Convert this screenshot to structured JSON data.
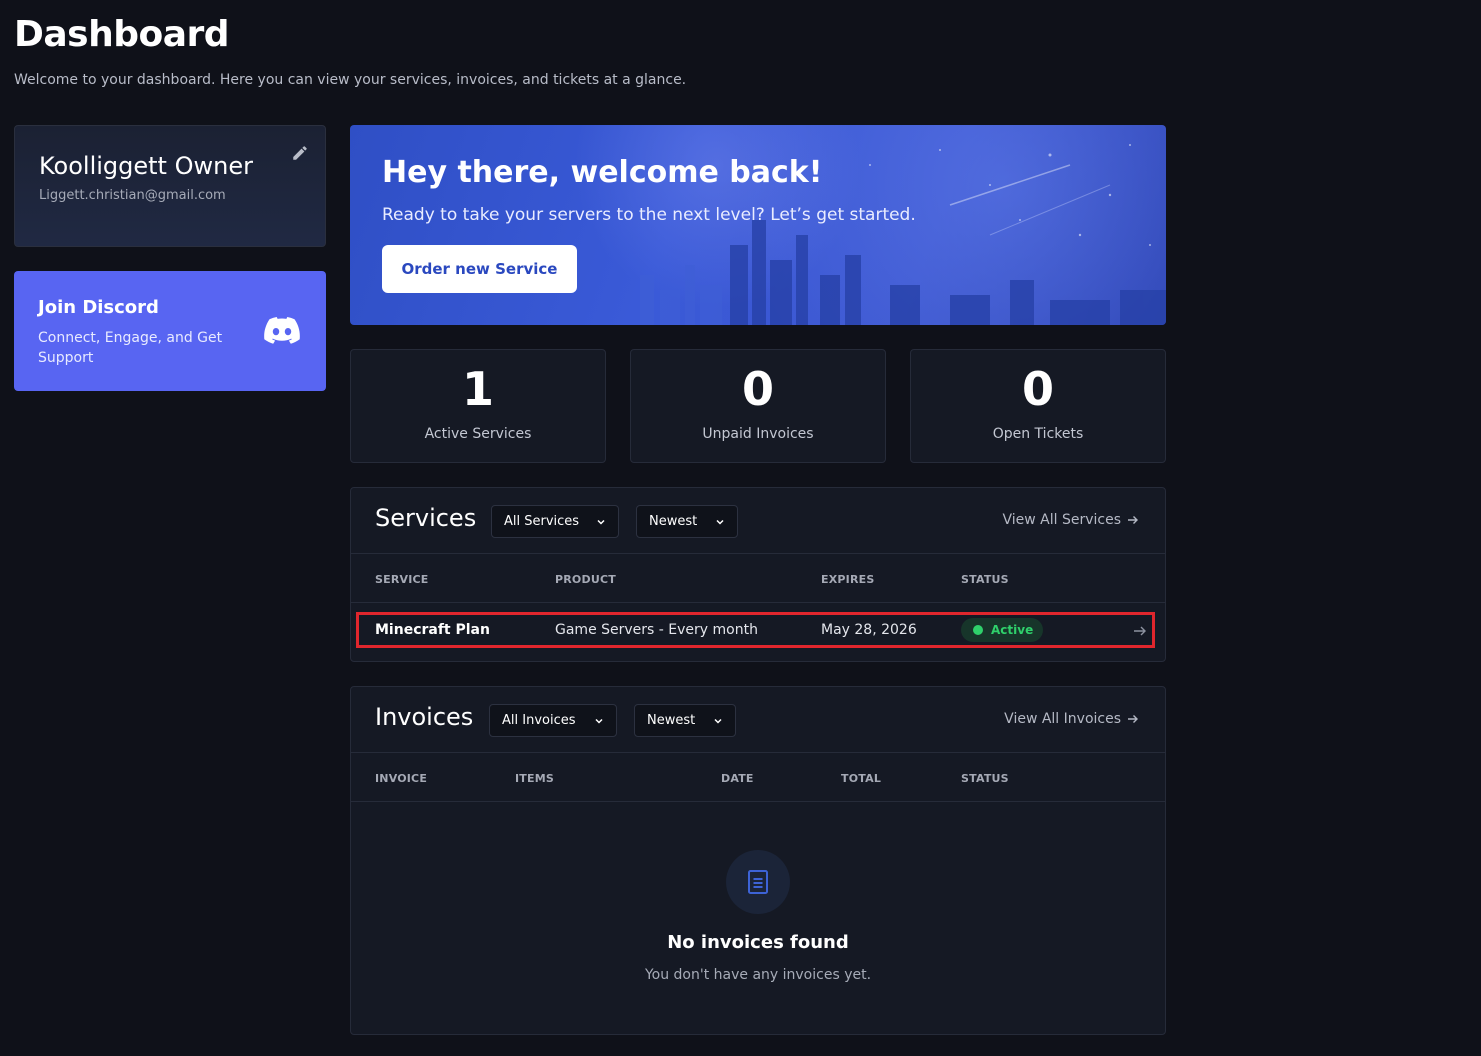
{
  "page": {
    "title": "Dashboard",
    "subtitle": "Welcome to your dashboard. Here you can view your services, invoices, and tickets at a glance."
  },
  "profile": {
    "name": "Koolliggett Owner",
    "email": "Liggett.christian@gmail.com",
    "edit_icon": "pencil-icon"
  },
  "discord": {
    "title": "Join Discord",
    "description": "Connect, Engage, and Get Support",
    "icon": "discord-icon",
    "color": "#5865f2"
  },
  "hero": {
    "title": "Hey there, welcome back!",
    "subtitle": "Ready to take your servers to the next level? Let’s get started.",
    "button_label": "Order new Service"
  },
  "stats": [
    {
      "value": "1",
      "label": "Active Services"
    },
    {
      "value": "0",
      "label": "Unpaid Invoices"
    },
    {
      "value": "0",
      "label": "Open Tickets"
    }
  ],
  "services": {
    "title": "Services",
    "filter": "All Services",
    "sort": "Newest",
    "view_all": "View All Services",
    "columns": [
      "SERVICE",
      "PRODUCT",
      "EXPIRES",
      "STATUS"
    ],
    "rows": [
      {
        "service": "Minecraft Plan",
        "product": "Game Servers - Every month",
        "expires": "May 28, 2026",
        "status": "Active"
      }
    ]
  },
  "invoices": {
    "title": "Invoices",
    "filter": "All Invoices",
    "sort": "Newest",
    "view_all": "View All Invoices",
    "columns": [
      "INVOICE",
      "ITEMS",
      "DATE",
      "TOTAL",
      "STATUS"
    ],
    "empty_title": "No invoices found",
    "empty_subtitle": "You don't have any invoices yet.",
    "empty_icon": "document-icon"
  },
  "colors": {
    "background": "#0f1119",
    "card": "#151924",
    "accent": "#2a48bf",
    "status_active": "#2fd06b",
    "highlight": "#e0262d"
  }
}
